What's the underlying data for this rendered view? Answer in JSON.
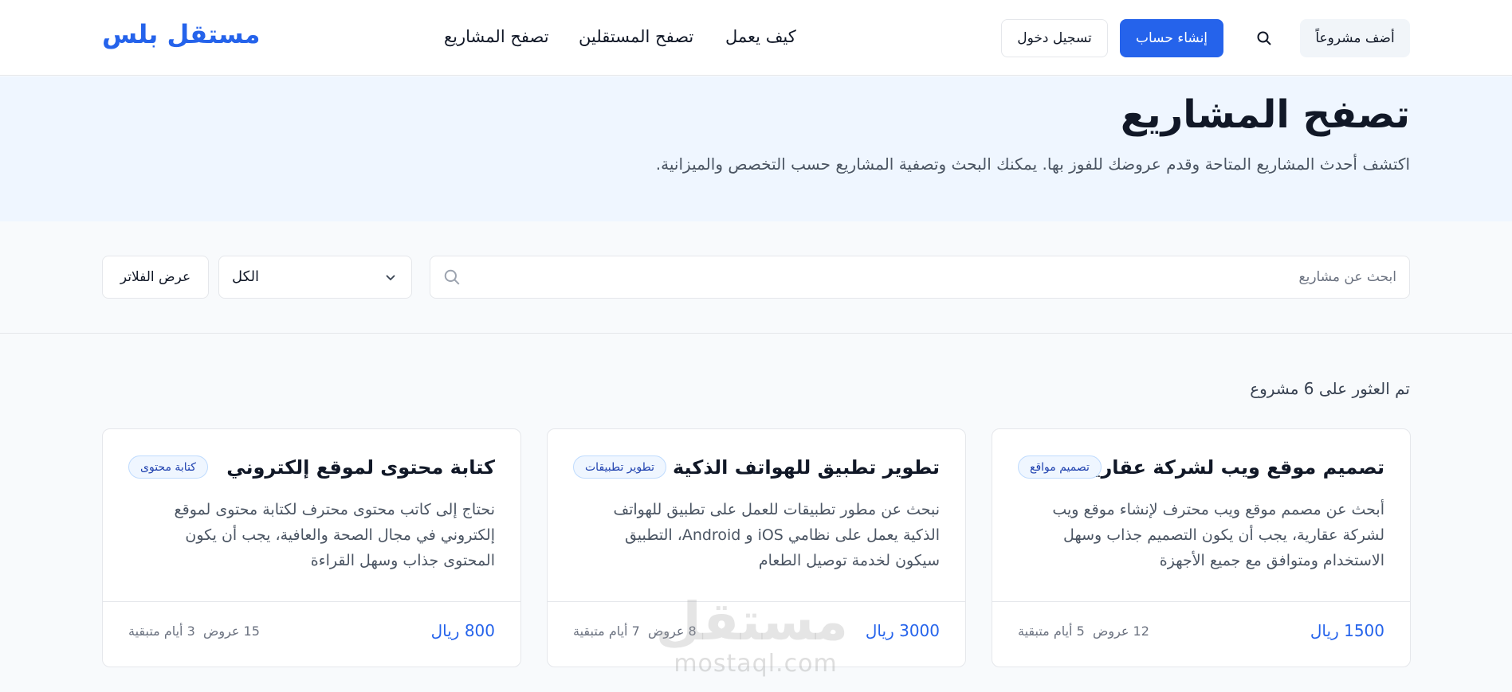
{
  "header": {
    "brand": "مستقل بلس",
    "nav": [
      "تصفح المشاريع",
      "تصفح المستقلين",
      "كيف يعمل"
    ],
    "login_label": "تسجيل دخول",
    "signup_label": "إنشاء حساب",
    "add_project_label": "أضف مشروعاً",
    "search_icon": "search-icon"
  },
  "hero": {
    "title": "تصفح المشاريع",
    "subtitle": "اكتشف أحدث المشاريع المتاحة وقدم عروضك للفوز بها. يمكنك البحث وتصفية المشاريع حسب التخصص والميزانية."
  },
  "filters": {
    "search_placeholder": "ابحث عن مشاريع",
    "category_selected": "الكل",
    "show_filters_label": "عرض الفلاتر"
  },
  "results": {
    "count_text": "تم العثور على 6 مشروع"
  },
  "projects": [
    {
      "title": "تصميم موقع ويب لشركة عقارية",
      "tag": "تصميم مواقع",
      "description": "أبحث عن مصمم موقع ويب محترف لإنشاء موقع ويب لشركة عقارية، يجب أن يكون التصميم جذاب وسهل الاستخدام ومتوافق مع جميع الأجهزة",
      "budget": "1500 ريال",
      "offers": "12 عروض",
      "days_left": "5 أيام متبقية"
    },
    {
      "title": "تطوير تطبيق للهواتف الذكية",
      "tag": "تطوير تطبيقات",
      "description": "نبحث عن مطور تطبيقات للعمل على تطبيق للهواتف الذكية يعمل على نظامي iOS و Android، التطبيق سيكون لخدمة توصيل الطعام",
      "budget": "3000 ريال",
      "offers": "8 عروض",
      "days_left": "7 أيام متبقية"
    },
    {
      "title": "كتابة محتوى لموقع إلكتروني",
      "tag": "كتابة محتوى",
      "description": "نحتاج إلى كاتب محتوى محترف لكتابة محتوى لموقع إلكتروني في مجال الصحة والعافية، يجب أن يكون المحتوى جذاب وسهل القراءة",
      "budget": "800 ريال",
      "offers": "15 عروض",
      "days_left": "3 أيام متبقية"
    }
  ],
  "watermark": {
    "mark": "مستقل",
    "url": "mostaql.com"
  },
  "colors": {
    "accent": "#2563eb",
    "hero_bg": "#eff6ff",
    "tag_bg": "#eff6ff"
  }
}
